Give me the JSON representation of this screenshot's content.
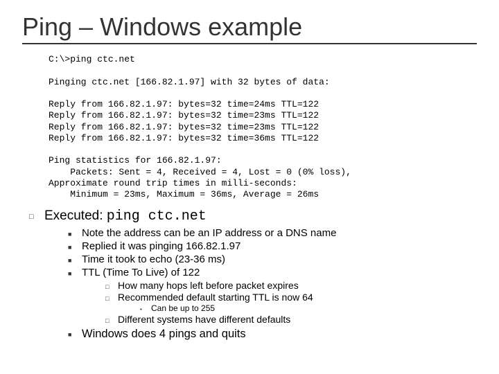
{
  "title": "Ping – Windows example",
  "code": "C:\\>ping ctc.net\n\nPinging ctc.net [166.82.1.97] with 32 bytes of data:\n\nReply from 166.82.1.97: bytes=32 time=24ms TTL=122\nReply from 166.82.1.97: bytes=32 time=23ms TTL=122\nReply from 166.82.1.97: bytes=32 time=23ms TTL=122\nReply from 166.82.1.97: bytes=32 time=36ms TTL=122\n\nPing statistics for 166.82.1.97:\n    Packets: Sent = 4, Received = 4, Lost = 0 (0% loss),\nApproximate round trip times in milli-seconds:\n    Minimum = 23ms, Maximum = 36ms, Average = 26ms",
  "exec_label": "Executed:",
  "exec_cmd": "ping ctc.net",
  "sub": {
    "a": "Note the address can be an IP address or a DNS name",
    "b": "Replied it was pinging 166.82.1.97",
    "c": "Time it took to echo (23-36 ms)",
    "d": "TTL (Time To Live) of 122",
    "e": "How many hops left before packet expires",
    "f": "Recommended default starting TTL is now 64",
    "g": "Can be up to 255",
    "h": "Different systems have different defaults",
    "i": "Windows does 4 pings and quits"
  }
}
